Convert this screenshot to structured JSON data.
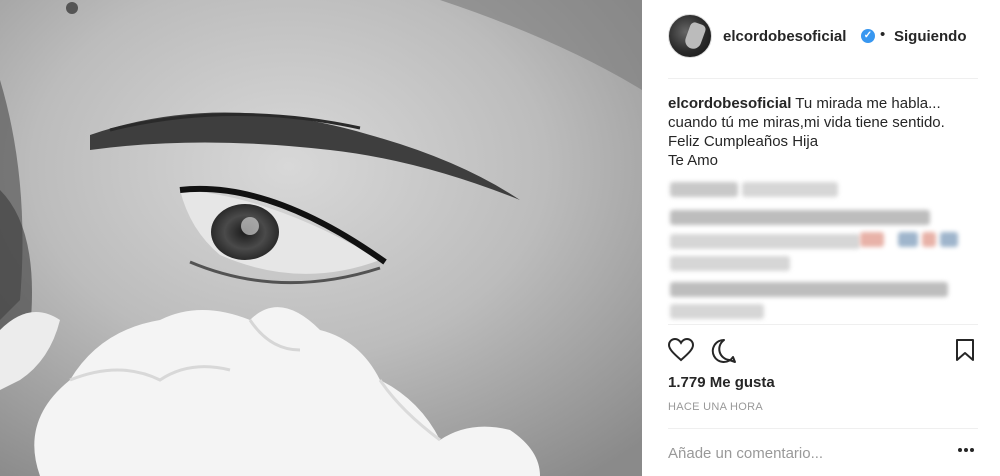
{
  "post": {
    "image_alt": "Black and white close-up of an eye with white flowers",
    "author": "elcordobesoficial",
    "verified_icon": "verified-badge-icon",
    "follow_state": "Siguiendo",
    "separator": "•",
    "caption": {
      "user": "elcordobesoficial",
      "lines": [
        "Tu mirada me habla...",
        "cuando tú me miras,mi vida tiene sentido.",
        "Feliz Cumpleaños Hija",
        "Te Amo"
      ]
    },
    "likes": "1.779 Me gusta",
    "time": "HACE UNA HORA",
    "comment_placeholder": "Añade un comentario...",
    "more_label": "•••"
  },
  "icons": {
    "like": "heart-icon",
    "comment": "comment-bubble-icon",
    "save": "bookmark-icon",
    "more": "more-options-icon"
  },
  "colors": {
    "verified": "#3897f0",
    "text": "#262626",
    "muted": "#999999",
    "divider": "#efefef"
  }
}
